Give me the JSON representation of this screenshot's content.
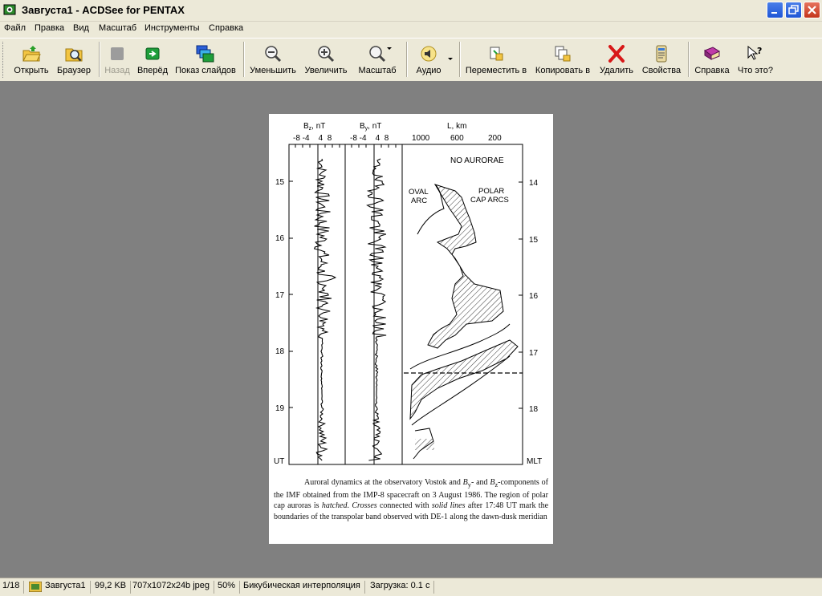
{
  "window": {
    "title": "Завгуста1 - ACDSee for PENTAX",
    "colors": {
      "accent": "#1f56d6",
      "close": "#c3341a",
      "viewer_bg": "#808080",
      "chrome": "#ece9d8"
    }
  },
  "menu": [
    {
      "label": "Файл"
    },
    {
      "label": "Правка"
    },
    {
      "label": "Вид"
    },
    {
      "label": "Масштаб"
    },
    {
      "label": "Инструменты"
    },
    {
      "label": "Справка"
    }
  ],
  "toolbar": {
    "open": "Открыть",
    "browser": "Браузер",
    "back": "Назад",
    "forward": "Вперёд",
    "slideshow": "Показ слайдов",
    "zoom_out": "Уменьшить",
    "zoom_in": "Увеличить",
    "zoom": "Масштаб",
    "audio": "Аудио",
    "move_to": "Переместить в",
    "copy_to": "Копировать в",
    "delete": "Удалить",
    "properties": "Свойства",
    "help": "Справка",
    "whats_this": "Что это?"
  },
  "figure": {
    "bz_label": "B",
    "bz_sub": "z",
    "bz_unit": ", nT",
    "by_label": "B",
    "by_sub": "y",
    "by_unit": ", nT",
    "l_label": "L, km",
    "bz_ticks": "-8 -4    4  8",
    "by_ticks": "-8 -4    4  8",
    "l_ticks": [
      "1000",
      "600",
      "200"
    ],
    "ut_ticks": [
      "15",
      "16",
      "17",
      "18",
      "19"
    ],
    "mlt_ticks": [
      "14",
      "15",
      "16",
      "17",
      "18"
    ],
    "ut_label": "UT",
    "mlt_label": "MLT",
    "no_aurorae": "NO AURORAE",
    "oval_arc_1": "OVAL",
    "oval_arc_2": "ARC",
    "polar_1": "POLAR",
    "polar_2": "CAP ARCS"
  },
  "caption": {
    "p1": "Auroral dynamics at the observatory Vostok and ",
    "by": "B",
    "by_sub": "y",
    "p2": "- and ",
    "bz": "B",
    "bz_sub": "z",
    "p3": "-components of the IMF obtained from the IMP-8 spacecraft on 3 August 1986. The region of polar cap auroras is ",
    "hatched": "hatched",
    "p4": ". ",
    "crosses": "Crosses",
    "p5": " connected with ",
    "solid": "solid lines",
    "p6": " after 17:48 UT mark the boundaries of the transpolar band observed with DE-1 along the dawn-dusk meridian"
  },
  "status": {
    "index": "1/18",
    "filename": "Завгуста1",
    "size": "99,2 KB",
    "dims": "707x1072x24b jpeg",
    "zoom": "50%",
    "interp": "Бикубическая интерполяция",
    "load": "Загрузка: 0.1 с"
  }
}
